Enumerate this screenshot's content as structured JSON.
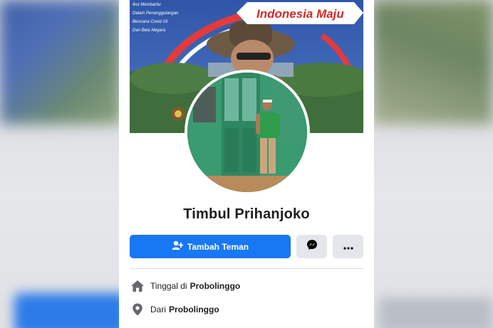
{
  "cover": {
    "banner_text": "Indonesia Maju",
    "small_lines": [
      "Ikut Membantu",
      "Dalam Penanggulangan",
      "Bencana Covid 19",
      "Dan Bela Negara"
    ]
  },
  "profile": {
    "name": "Timbul Prihanjoko"
  },
  "actions": {
    "add_friend_label": "Tambah Teman"
  },
  "info": {
    "lives_prefix": "Tinggal di",
    "lives_place": "Probolinggo",
    "from_prefix": "Dari",
    "from_place": "Probolinggo"
  },
  "icons": {
    "add_friend": "add-friend-icon",
    "messenger": "messenger-icon",
    "more": "more-icon",
    "home": "home-icon",
    "location": "location-pin-icon"
  },
  "colors": {
    "primary": "#1877f2",
    "secondary_button": "#e4e6eb",
    "text": "#1c1e21",
    "icon_gray": "#65676b"
  }
}
